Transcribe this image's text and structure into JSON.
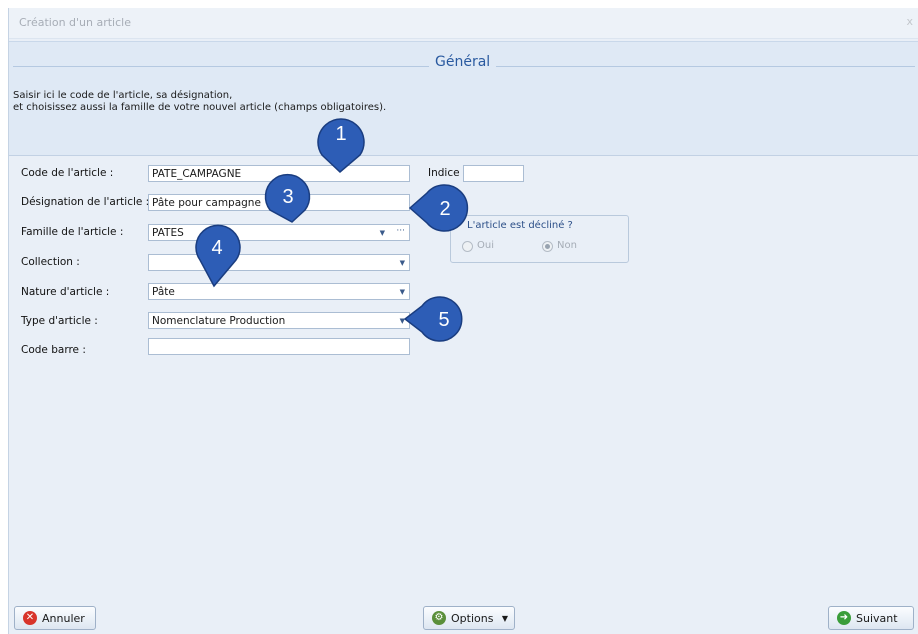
{
  "window": {
    "title": "Création d'un article",
    "close_label": "x"
  },
  "header": {
    "title": "Général",
    "description_line1": "Saisir ici le code de l'article, sa désignation,",
    "description_line2": "et choisissez aussi la famille de votre nouvel article (champs obligatoires)."
  },
  "form": {
    "code_label": "Code de l'article :",
    "code_value": "PATE_CAMPAGNE",
    "indice_label": "Indice :",
    "indice_value": "",
    "designation_label": "Désignation de l'article :",
    "designation_value": "Pâte pour campagne",
    "famille_label": "Famille de l'article :",
    "famille_value": "PATES",
    "famille_more": "···",
    "collection_label": "Collection :",
    "collection_value": "",
    "nature_label": "Nature d'article :",
    "nature_value": "Pâte",
    "type_label": "Type d'article :",
    "type_value": "Nomenclature Production",
    "codebarre_label": "Code barre :",
    "codebarre_value": ""
  },
  "declinaison": {
    "title": "L'article est décliné ?",
    "oui_label": "Oui",
    "non_label": "Non",
    "selected": "Non"
  },
  "footer": {
    "cancel_label": "Annuler",
    "options_label": "Options",
    "next_label": "Suivant"
  },
  "callouts": [
    "1",
    "2",
    "3",
    "4",
    "5"
  ],
  "colors": {
    "callout_fill": "#2d5db6",
    "accent": "#2a5aa0"
  }
}
